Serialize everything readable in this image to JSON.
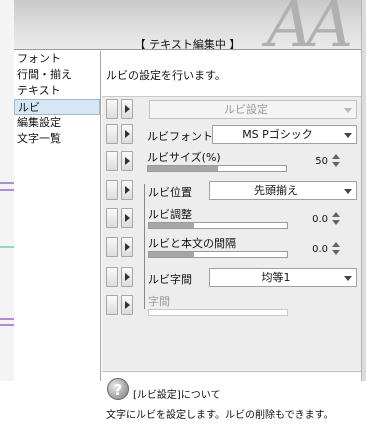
{
  "header": {
    "title": "【 テキスト編集中 】",
    "decoration": "AA"
  },
  "categories": [
    {
      "label": "フォント"
    },
    {
      "label": "行間・揃え"
    },
    {
      "label": "テキスト"
    },
    {
      "label": "ルビ"
    },
    {
      "label": "編集設定"
    },
    {
      "label": "文字一覧"
    }
  ],
  "selected_category": "ルビ",
  "panel": {
    "description": "ルビの設定を行います。",
    "ruby_settings_combo": "ルビ設定",
    "ruby_font": {
      "label": "ルビフォント",
      "value": "MS Pゴシック"
    },
    "ruby_size": {
      "label": "ルビサイズ(%)",
      "value": "50",
      "fill": 0.5
    },
    "ruby_position": {
      "label": "ルビ位置",
      "value": "先頭揃え"
    },
    "ruby_adjust": {
      "label": "ルビ調整",
      "value": "0.0",
      "fill": 0.32
    },
    "ruby_gap": {
      "label": "ルビと本文の間隔",
      "value": "0.0",
      "fill": 0.32
    },
    "ruby_spacing": {
      "label": "ルビ字間",
      "value": "均等1"
    },
    "char_spacing": {
      "label": "字間"
    }
  },
  "help": {
    "icon": "?",
    "title": "[ルビ設定]について",
    "text": "文字にルビを設定します。ルビの削除もできます。"
  },
  "colors": {
    "selection": "#d7e6f4",
    "mark_purple": "#b48cd6",
    "mark_teal": "#8fd6cf"
  }
}
